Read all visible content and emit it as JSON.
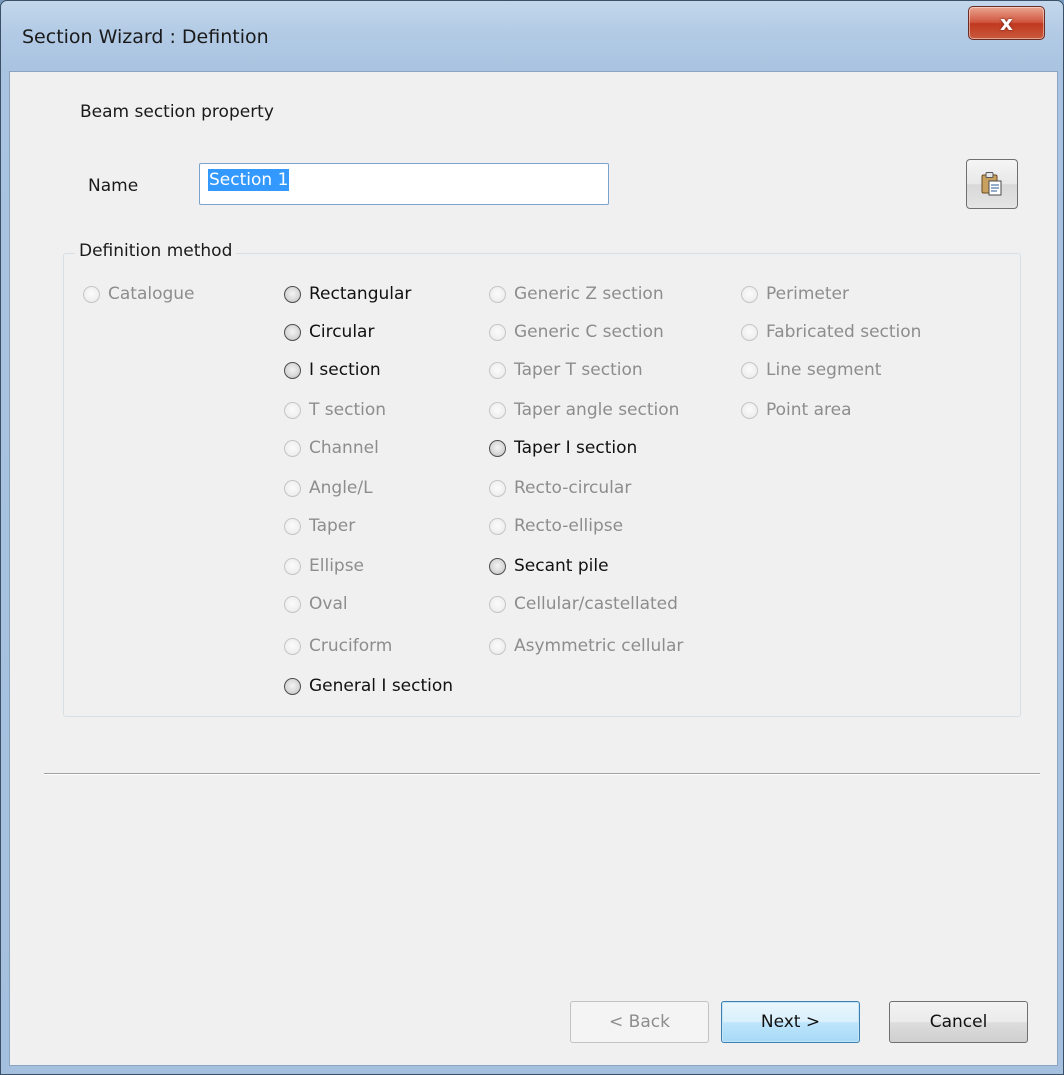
{
  "window": {
    "title": "Section Wizard : Defintion",
    "close_label": "x"
  },
  "main": {
    "heading": "Beam section property",
    "name_label": "Name",
    "name_value": "Section 1",
    "group_label": "Definition method"
  },
  "options": [
    {
      "label": "Catalogue",
      "enabled": false
    },
    {
      "label": "Rectangular",
      "enabled": true
    },
    {
      "label": "Circular",
      "enabled": true
    },
    {
      "label": "I section",
      "enabled": true
    },
    {
      "label": "T section",
      "enabled": false
    },
    {
      "label": "Channel",
      "enabled": false
    },
    {
      "label": "Angle/L",
      "enabled": false
    },
    {
      "label": "Taper",
      "enabled": false
    },
    {
      "label": "Ellipse",
      "enabled": false
    },
    {
      "label": "Oval",
      "enabled": false
    },
    {
      "label": "Cruciform",
      "enabled": false
    },
    {
      "label": "General I section",
      "enabled": true
    },
    {
      "label": "Generic Z section",
      "enabled": false
    },
    {
      "label": "Generic C section",
      "enabled": false
    },
    {
      "label": "Taper T section",
      "enabled": false
    },
    {
      "label": "Taper angle section",
      "enabled": false
    },
    {
      "label": "Taper I section",
      "enabled": true
    },
    {
      "label": "Recto-circular",
      "enabled": false
    },
    {
      "label": "Recto-ellipse",
      "enabled": false
    },
    {
      "label": "Secant pile",
      "enabled": true
    },
    {
      "label": "Cellular/castellated",
      "enabled": false
    },
    {
      "label": "Asymmetric cellular",
      "enabled": false
    },
    {
      "label": "Perimeter",
      "enabled": false
    },
    {
      "label": "Fabricated section",
      "enabled": false
    },
    {
      "label": "Line segment",
      "enabled": false
    },
    {
      "label": "Point area",
      "enabled": false
    }
  ],
  "footer": {
    "back_label": "< Back",
    "next_label": "Next >",
    "cancel_label": "Cancel"
  },
  "icons": {
    "paste": "paste-from-clipboard-icon"
  }
}
